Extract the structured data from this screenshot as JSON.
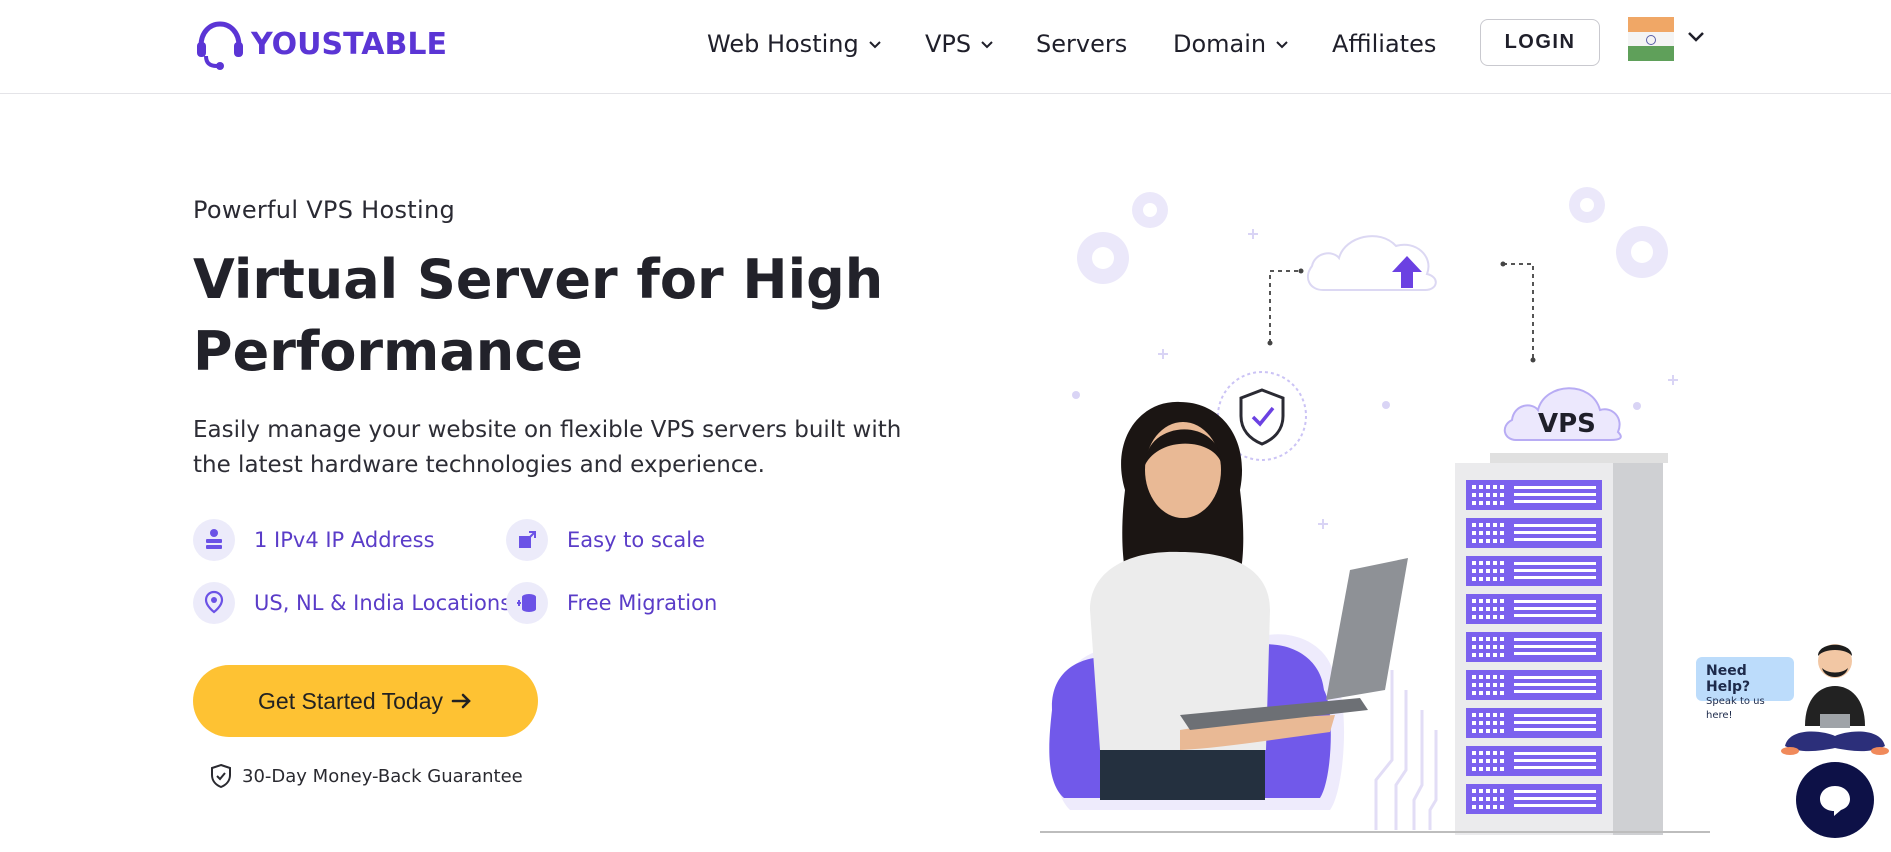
{
  "brand": {
    "name": "YOUSTABLE",
    "color": "#5b35d5"
  },
  "nav": {
    "items": [
      {
        "label": "Web Hosting",
        "dropdown": true
      },
      {
        "label": "VPS",
        "dropdown": true
      },
      {
        "label": "Servers",
        "dropdown": false
      },
      {
        "label": "Domain",
        "dropdown": true
      },
      {
        "label": "Affiliates",
        "dropdown": false
      }
    ],
    "login_label": "LOGIN",
    "flag_icon": "india-flag-icon"
  },
  "hero": {
    "eyebrow": "Powerful VPS Hosting",
    "headline": "Virtual Server for High Performance",
    "lead": "Easily manage your website on flexible VPS servers built with the latest hardware technologies and experience.",
    "features": [
      {
        "label": "1 IPv4 IP Address",
        "icon": "ip-server-icon"
      },
      {
        "label": "Easy to scale",
        "icon": "scale-icon"
      },
      {
        "label": "US, NL & India Locations",
        "icon": "location-pin-icon"
      },
      {
        "label": "Free Migration",
        "icon": "database-migration-icon"
      }
    ],
    "cta_label": "Get Started Today",
    "guarantee": "30-Day Money-Back Guarantee"
  },
  "illustration": {
    "vps_badge": "VPS",
    "accent": "#6b52e6"
  },
  "chat": {
    "bubble_title": "Need Help?",
    "bubble_sub": "Speak to us here!"
  },
  "colors": {
    "cta": "#fec233",
    "feature_text": "#5a3cc8",
    "chat_button": "#0d1147"
  }
}
